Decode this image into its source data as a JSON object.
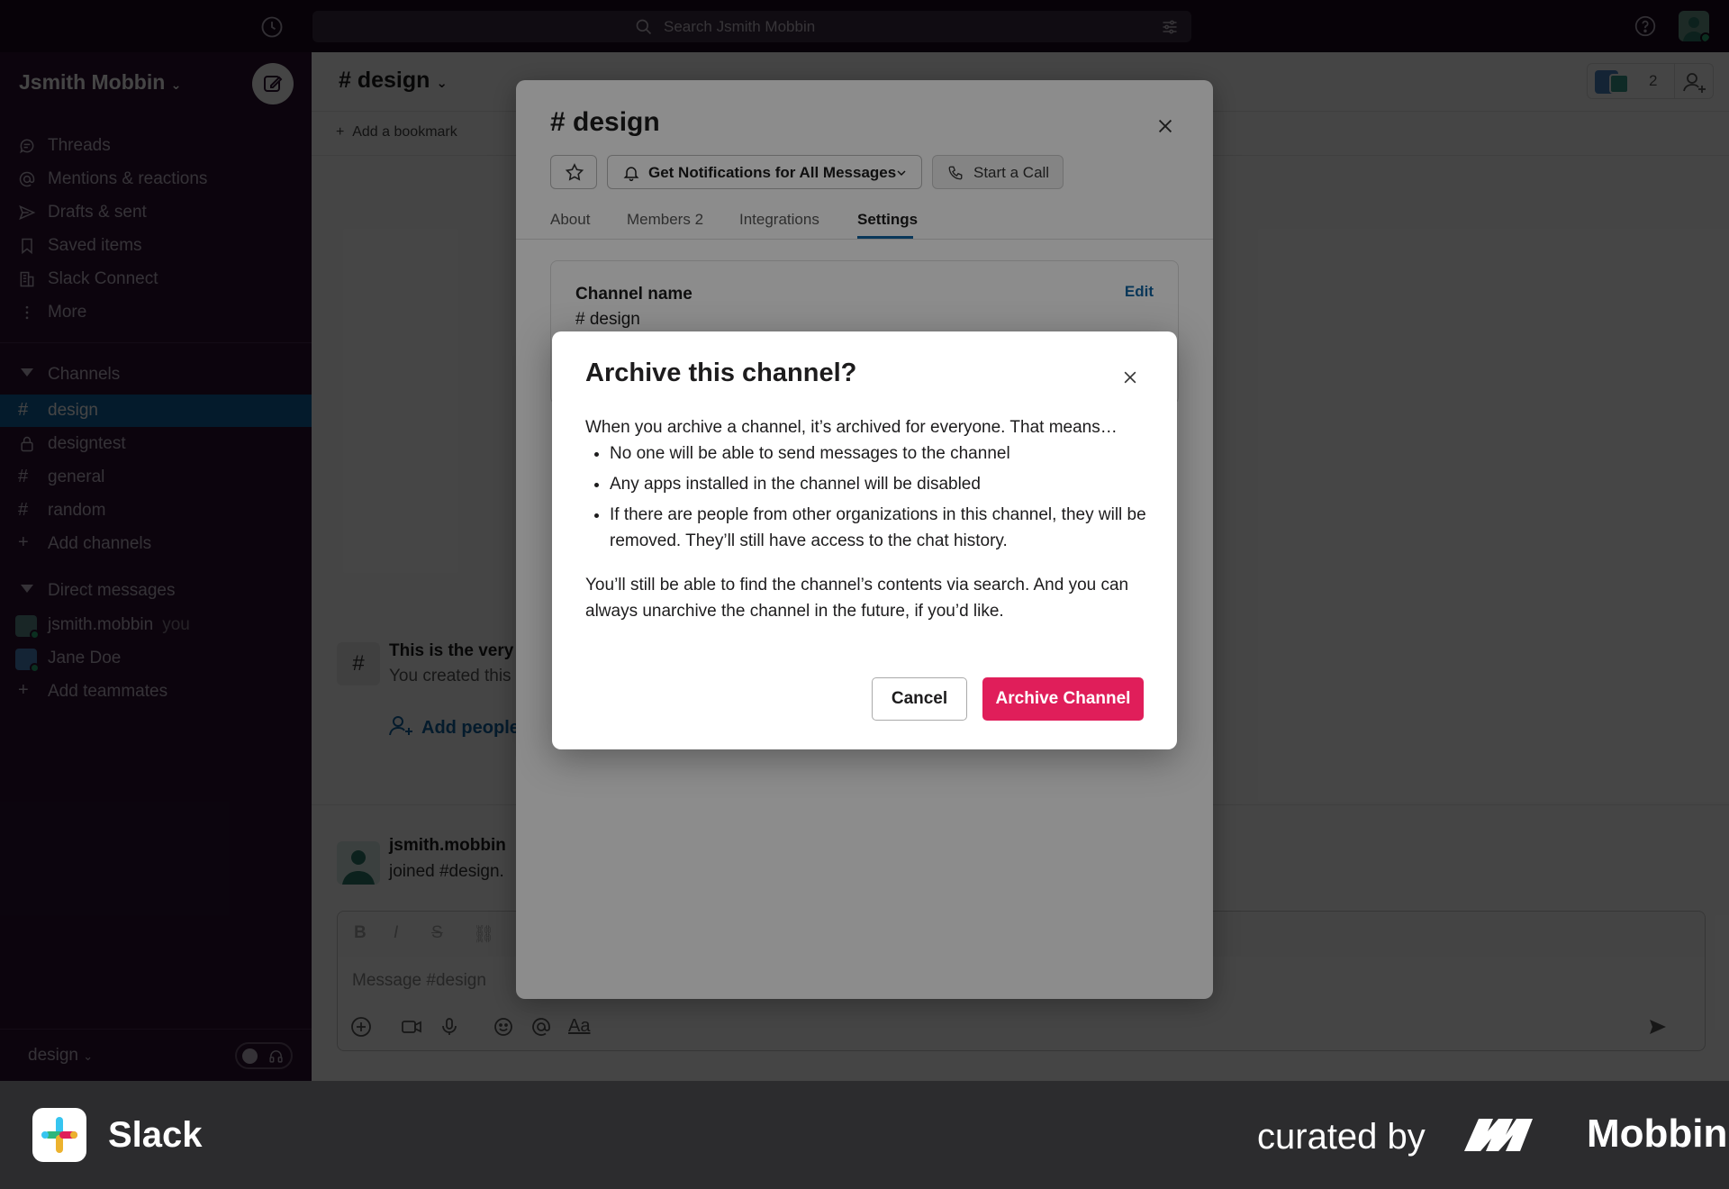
{
  "topbar": {
    "search_placeholder": "Search Jsmith Mobbin"
  },
  "sidebar": {
    "workspace": "Jsmith Mobbin",
    "nav": [
      {
        "label": "Threads",
        "icon": "threads-icon"
      },
      {
        "label": "Mentions & reactions",
        "icon": "at-icon"
      },
      {
        "label": "Drafts & sent",
        "icon": "send-icon"
      },
      {
        "label": "Saved items",
        "icon": "bookmark-icon"
      },
      {
        "label": "Slack Connect",
        "icon": "building-icon"
      },
      {
        "label": "More",
        "icon": "more-icon"
      }
    ],
    "channels_header": "Channels",
    "channels": [
      {
        "prefix": "#",
        "name": "design",
        "active": true
      },
      {
        "prefix": "lock",
        "name": "designtest",
        "active": false
      },
      {
        "prefix": "#",
        "name": "general",
        "active": false
      },
      {
        "prefix": "#",
        "name": "random",
        "active": false
      }
    ],
    "add_channels": "Add channels",
    "dm_header": "Direct messages",
    "dms": [
      {
        "name": "jsmith.mobbin",
        "tag": "you"
      },
      {
        "name": "Jane Doe",
        "tag": ""
      }
    ],
    "add_teammates": "Add teammates",
    "footer_label": "design"
  },
  "channel": {
    "title": "# design",
    "member_count": "2",
    "add_bookmark": "Add a bookmark",
    "intro_title": "This is the very",
    "intro_sub": "You created this",
    "add_people": "Add people",
    "message_author": "jsmith.mobbin",
    "message_text": "joined #design.",
    "composer_placeholder": "Message #design"
  },
  "details": {
    "title": "# design",
    "notifications_label": "Get Notifications for All Messages",
    "call_label": "Start a Call",
    "tabs": [
      {
        "label": "About",
        "active": false
      },
      {
        "label": "Members 2",
        "active": false
      },
      {
        "label": "Integrations",
        "active": false
      },
      {
        "label": "Settings",
        "active": true
      }
    ],
    "card_label": "Channel name",
    "card_value": "# design",
    "card_edit": "Edit"
  },
  "modal": {
    "title": "Archive this channel?",
    "intro": "When you archive a channel, it’s archived for everyone. That means…",
    "bullets": [
      "No one will be able to send messages to the channel",
      "Any apps installed in the channel will be disabled",
      "If there are people from other organizations in this channel, they will be removed. They’ll still have access to the chat history."
    ],
    "outro": "You’ll still be able to find the channel’s contents via search. And you can always unarchive the channel in the future, if you’d like.",
    "cancel_label": "Cancel",
    "archive_label": "Archive Channel",
    "archive_color": "#e01e5a"
  },
  "footer": {
    "app_name": "Slack",
    "curated_by": "curated by",
    "brand": "Mobbin"
  }
}
